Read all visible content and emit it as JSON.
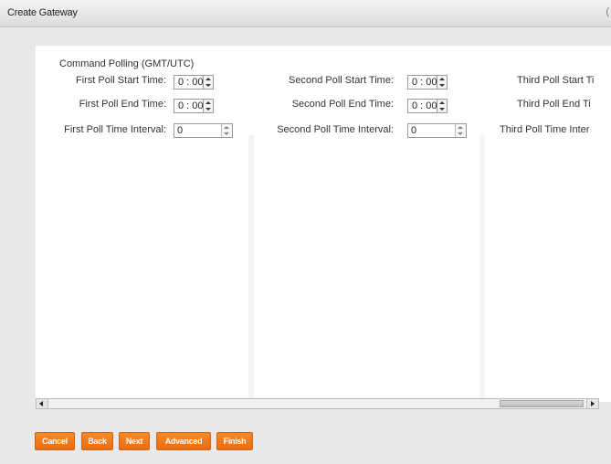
{
  "window": {
    "title": "Create Gateway",
    "close_glyph": "("
  },
  "section": {
    "title": "Command Polling (GMT/UTC)"
  },
  "columns": [
    {
      "start_label": "First Poll Start Time:",
      "start_value": "0 : 00",
      "end_label": "First Poll End Time:",
      "end_value": "0 : 00",
      "interval_label": "First Poll Time Interval:",
      "interval_value": "0"
    },
    {
      "start_label": "Second Poll Start Time:",
      "start_value": "0 : 00",
      "end_label": "Second Poll End Time:",
      "end_value": "0 : 00",
      "interval_label": "Second Poll Time Interval:",
      "interval_value": "0"
    },
    {
      "start_label": "Third Poll Start Ti",
      "end_label": "Third Poll End Ti",
      "interval_label": "Third Poll Time Inter"
    }
  ],
  "buttons": {
    "cancel": "Cancel",
    "back": "Back",
    "next": "Next",
    "advanced": "Advanced",
    "finish": "Finish"
  }
}
